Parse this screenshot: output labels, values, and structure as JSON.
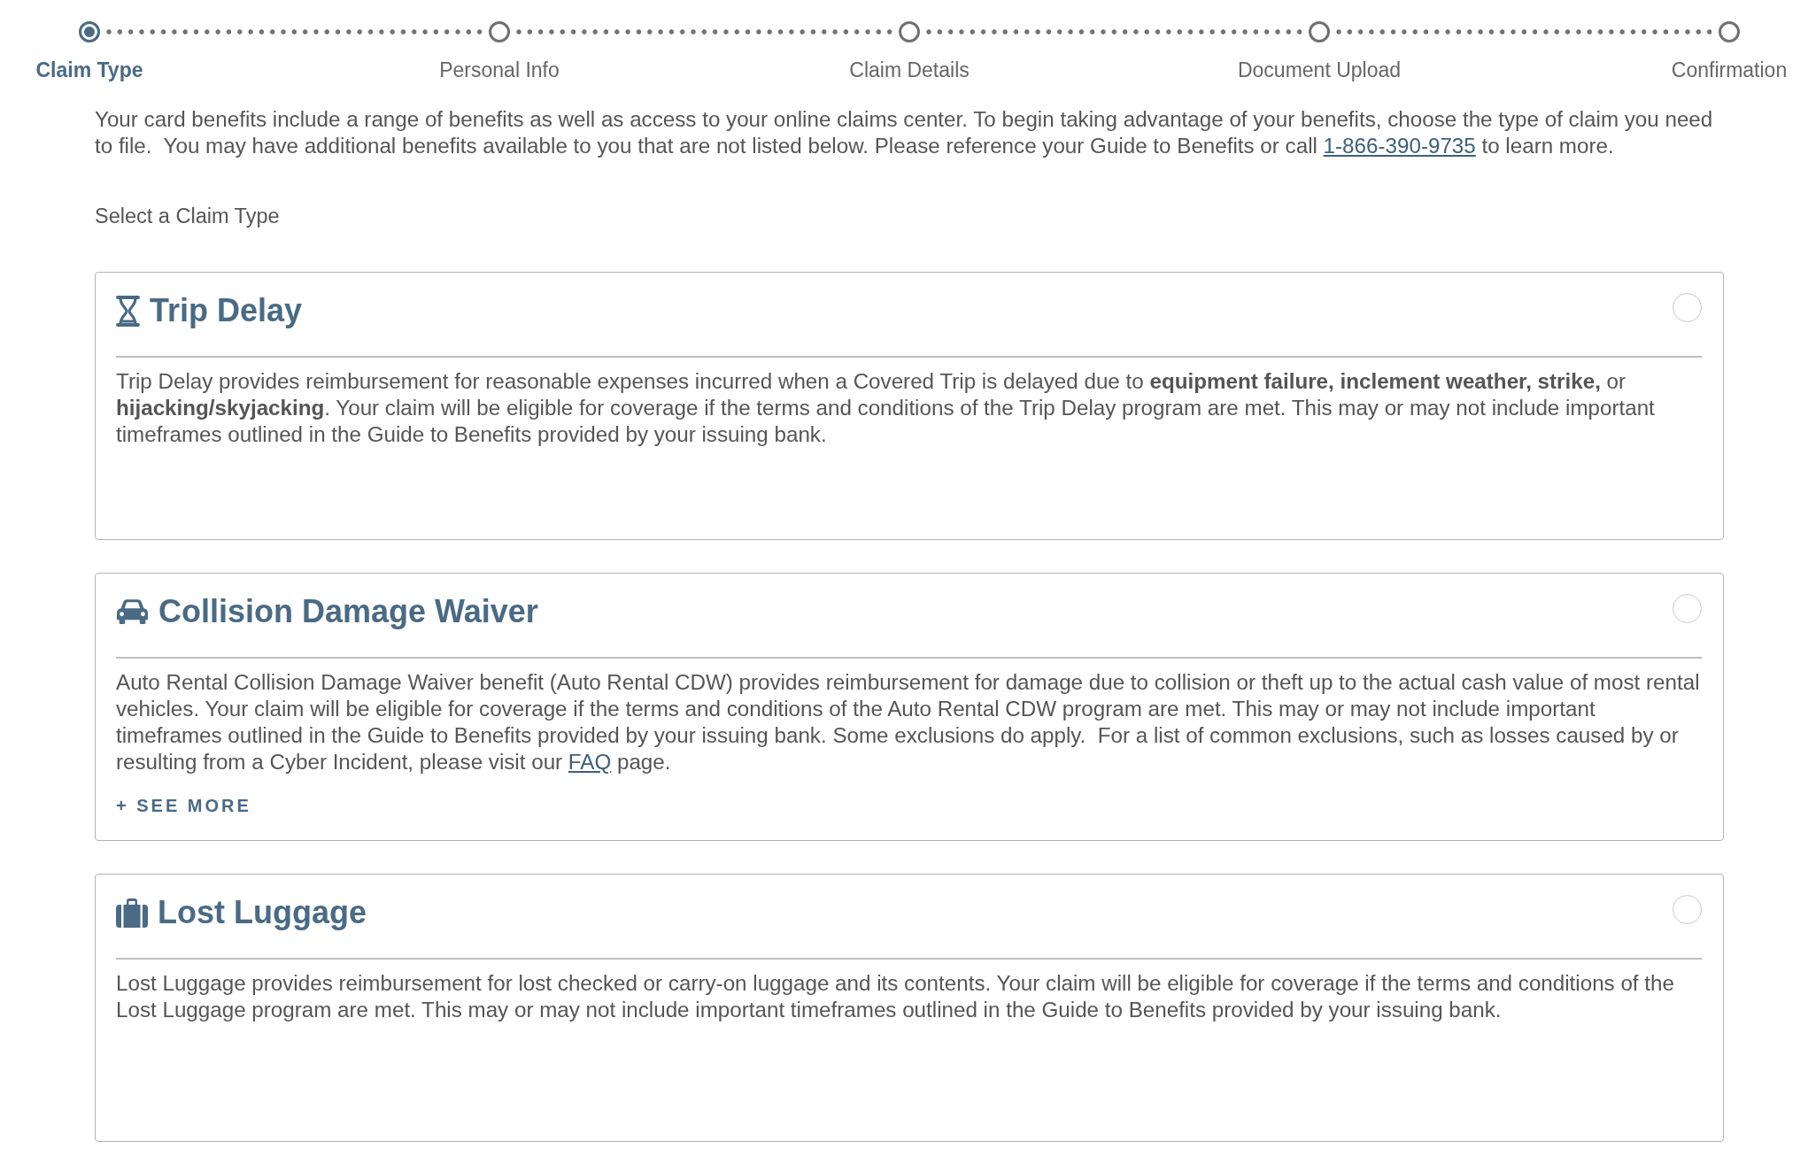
{
  "stepper": {
    "steps": [
      {
        "label": "Claim Type",
        "selected": true
      },
      {
        "label": "Personal Info",
        "selected": false
      },
      {
        "label": "Claim Details",
        "selected": false
      },
      {
        "label": "Document Upload",
        "selected": false
      },
      {
        "label": "Confirmation",
        "selected": false
      }
    ]
  },
  "intro": [
    {
      "kind": "text",
      "text": "Your card benefits include a range of benefits as well as access to your online claims center. To begin taking advantage of your benefits, choose the type of claim you need to file.  You may have additional benefits available to you that are not listed below. Please reference your Guide to Benefits or call "
    },
    {
      "kind": "link",
      "text": "1-866-390-9735"
    },
    {
      "kind": "text",
      "text": " to learn more."
    }
  ],
  "section_label": "Select a Claim Type",
  "claim_types": [
    {
      "title": "Trip Delay",
      "selected": false,
      "description": [
        {
          "kind": "text",
          "text": "Trip Delay provides reimbursement for reasonable expenses incurred when a Covered Trip is delayed due to **equipment failure, inclement weather, strike,** or **hijacking/skyjacking**. Your claim will be eligible for coverage if the terms and conditions of the Trip Delay program are met. This may or may not include important timeframes outlined in the Guide to Benefits provided by your issuing bank."
        }
      ]
    },
    {
      "title": "Collision Damage Waiver",
      "selected": false,
      "description": [
        {
          "kind": "text",
          "text": "Auto Rental Collision Damage Waiver benefit (Auto Rental CDW) provides reimbursement for damage due to collision or theft up to the actual cash value of most rental vehicles. Your claim will be eligible for coverage if the terms and conditions of the Auto Rental CDW program are met. This may or may not include important timeframes outlined in the Guide to Benefits provided by your issuing bank. Some exclusions do apply.  For a list of common exclusions, such as losses caused by or resulting from a Cyber Incident, please visit our "
        },
        {
          "kind": "link",
          "text": "FAQ"
        },
        {
          "kind": "text",
          "text": " page."
        }
      ],
      "see_more": "+ SEE MORE"
    },
    {
      "title": "Lost Luggage",
      "selected": false,
      "description": [
        {
          "kind": "text",
          "text": "Lost Luggage provides reimbursement for lost checked or carry-on luggage and its contents. Your claim will be eligible for coverage if the terms and conditions of the Lost Luggage program are met. This may or may not include important timeframes outlined in the Guide to Benefits provided by your issuing bank."
        }
      ]
    }
  ]
}
